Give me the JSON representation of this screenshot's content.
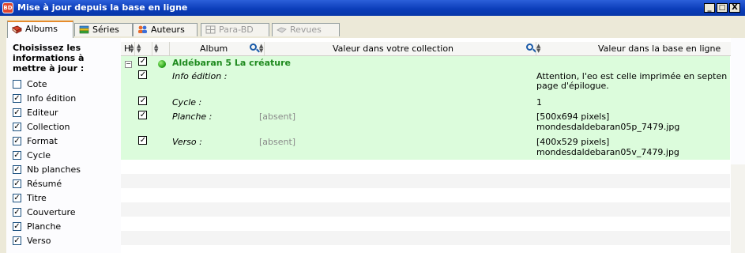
{
  "window": {
    "title": "Mise à jour depuis la base en ligne",
    "app_icon": "app-logo-icon",
    "controls": {
      "minimize": "_",
      "maximize": "□",
      "close": "X"
    }
  },
  "tabs": [
    {
      "label": "Albums",
      "icon": "book-red-icon",
      "state": "active"
    },
    {
      "label": "Séries",
      "icon": "books-stack-icon",
      "state": "normal"
    },
    {
      "label": "Auteurs",
      "icon": "people-icon",
      "state": "normal"
    },
    {
      "label": "Para-BD",
      "icon": "film-icon",
      "state": "disabled"
    },
    {
      "label": "Revues",
      "icon": "magazine-icon",
      "state": "disabled"
    }
  ],
  "left_panel": {
    "title": "Choisissez les informations à mettre à jour :",
    "options": [
      {
        "label": "Cote",
        "checked": false
      },
      {
        "label": "Info édition",
        "checked": true
      },
      {
        "label": "Editeur",
        "checked": true
      },
      {
        "label": "Collection",
        "checked": true
      },
      {
        "label": "Format",
        "checked": true
      },
      {
        "label": "Cycle",
        "checked": true
      },
      {
        "label": "Nb planches",
        "checked": true
      },
      {
        "label": "Résumé",
        "checked": true
      },
      {
        "label": "Titre",
        "checked": true
      },
      {
        "label": "Couverture",
        "checked": true
      },
      {
        "label": "Planche",
        "checked": true
      },
      {
        "label": "Verso",
        "checked": true
      }
    ]
  },
  "grid": {
    "columns": {
      "h": "H",
      "album": "Album",
      "collection_value": "Valeur dans votre collection",
      "online_value": "Valeur dans la base en ligne"
    },
    "album_row": {
      "checked": true,
      "status": "green-dot-icon",
      "title": "Aldébaran 5 La créature"
    },
    "rows": [
      {
        "field": "Info édition :",
        "collection": "",
        "online_lines": [
          "Attention, l'eo est celle imprimée en septen",
          "page d'épilogue."
        ],
        "checked": true
      },
      {
        "field": "Cycle :",
        "collection": "",
        "online_lines": [
          "1"
        ],
        "checked": true
      },
      {
        "field": "Planche :",
        "collection": "[absent]",
        "online_lines": [
          "[500x694 pixels]",
          "mondesdaldebaran05p_7479.jpg"
        ],
        "checked": true
      },
      {
        "field": "Verso :",
        "collection": "[absent]",
        "online_lines": [
          "[400x529 pixels]",
          "mondesdaldebaran05v_7479.jpg"
        ],
        "checked": true
      }
    ]
  },
  "colors": {
    "titlebar": "#0a3cb8",
    "row_highlight": "#dcfcdc",
    "album_title": "#1f8a1f",
    "active_tab_accent": "#e68b2c"
  }
}
